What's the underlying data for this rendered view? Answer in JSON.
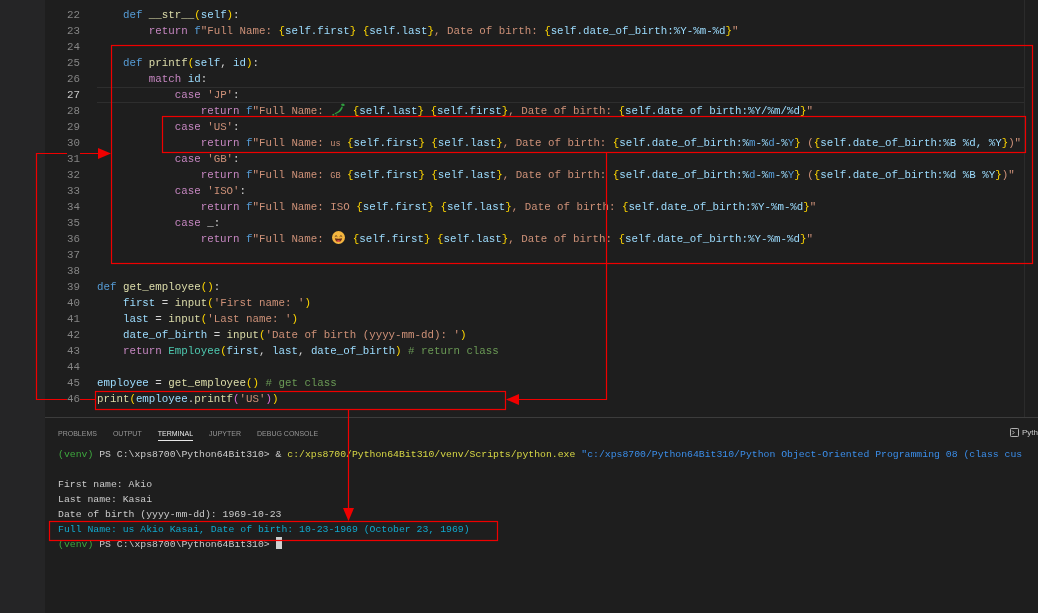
{
  "editor": {
    "lines": [
      {
        "number": "22",
        "current": false,
        "tokens": [
          {
            "kind": "keyword",
            "text": "    def "
          },
          {
            "kind": "function",
            "text": "__str__"
          },
          {
            "kind": "paren1",
            "text": "("
          },
          {
            "kind": "variable",
            "text": "self"
          },
          {
            "kind": "paren1",
            "text": ")"
          },
          {
            "kind": "plain",
            "text": ":"
          }
        ]
      },
      {
        "number": "23",
        "current": false,
        "tokens": [
          {
            "kind": "control",
            "text": "        return "
          },
          {
            "kind": "prefix",
            "text": "f"
          },
          {
            "kind": "string",
            "text": "\"Full Name: "
          },
          {
            "kind": "brace",
            "text": "{"
          },
          {
            "kind": "variable",
            "text": "self.first"
          },
          {
            "kind": "brace",
            "text": "} {"
          },
          {
            "kind": "variable",
            "text": "self.last"
          },
          {
            "kind": "brace",
            "text": "}"
          },
          {
            "kind": "string",
            "text": ", Date of birth: "
          },
          {
            "kind": "brace",
            "text": "{"
          },
          {
            "kind": "variable",
            "text": "self.date_of_birth:%Y-%m-%d"
          },
          {
            "kind": "brace",
            "text": "}"
          },
          {
            "kind": "string",
            "text": "\""
          }
        ]
      },
      {
        "number": "24",
        "current": false
      },
      {
        "number": "25",
        "current": false,
        "tokens": [
          {
            "kind": "keyword",
            "text": "    def "
          },
          {
            "kind": "function",
            "text": "printf"
          },
          {
            "kind": "paren1",
            "text": "("
          },
          {
            "kind": "variable",
            "text": "self"
          },
          {
            "kind": "plain",
            "text": ", "
          },
          {
            "kind": "variable",
            "text": "id"
          },
          {
            "kind": "paren1",
            "text": ")"
          },
          {
            "kind": "plain",
            "text": ":"
          }
        ]
      },
      {
        "number": "26",
        "current": false,
        "tokens": [
          {
            "kind": "control",
            "text": "        match "
          },
          {
            "kind": "variable",
            "text": "id"
          },
          {
            "kind": "plain",
            "text": ":"
          }
        ]
      },
      {
        "number": "27",
        "current": true,
        "tokens": [
          {
            "kind": "control",
            "text": "            case "
          },
          {
            "kind": "string",
            "text": "'JP'"
          },
          {
            "kind": "plain",
            "text": ":"
          }
        ]
      },
      {
        "number": "28",
        "current": false,
        "tokens": [
          {
            "kind": "control",
            "text": "                return "
          },
          {
            "kind": "prefix",
            "text": "f"
          },
          {
            "kind": "string",
            "text": "\"Full Name: "
          },
          {
            "kind": "map"
          },
          {
            "kind": "brace",
            "text": " {"
          },
          {
            "kind": "variable",
            "text": "self.last"
          },
          {
            "kind": "brace",
            "text": "} {"
          },
          {
            "kind": "variable",
            "text": "self.first"
          },
          {
            "kind": "brace",
            "text": "}"
          },
          {
            "kind": "string",
            "text": ", Date of birth: "
          },
          {
            "kind": "brace",
            "text": "{"
          },
          {
            "kind": "variable",
            "text": "self.date of birth:%Y/%m/%d"
          },
          {
            "kind": "brace",
            "text": "}"
          },
          {
            "kind": "string",
            "text": "\""
          }
        ]
      },
      {
        "number": "29",
        "current": false,
        "tokens": [
          {
            "kind": "control",
            "text": "            case "
          },
          {
            "kind": "string",
            "text": "'US'"
          },
          {
            "kind": "plain",
            "text": ":"
          }
        ]
      },
      {
        "number": "30",
        "current": false,
        "tokens": [
          {
            "kind": "control",
            "text": "                return "
          },
          {
            "kind": "prefix",
            "text": "f"
          },
          {
            "kind": "string",
            "text": "\"Full Name: "
          },
          {
            "kind": "flag",
            "text": "us"
          },
          {
            "kind": "brace",
            "text": " {"
          },
          {
            "kind": "variable",
            "text": "self.first"
          },
          {
            "kind": "brace",
            "text": "} {"
          },
          {
            "kind": "variable",
            "text": "self.last"
          },
          {
            "kind": "brace",
            "text": "}"
          },
          {
            "kind": "string",
            "text": ", Date of birth: "
          },
          {
            "kind": "brace",
            "text": "{"
          },
          {
            "kind": "variable",
            "text": "self.date_of_birth:%"
          },
          {
            "kind": "format",
            "text": "m"
          },
          {
            "kind": "variable",
            "text": "-%"
          },
          {
            "kind": "format",
            "text": "d"
          },
          {
            "kind": "variable",
            "text": "-%"
          },
          {
            "kind": "format",
            "text": "Y"
          },
          {
            "kind": "brace",
            "text": "}"
          },
          {
            "kind": "string",
            "text": " ("
          },
          {
            "kind": "brace",
            "text": "{"
          },
          {
            "kind": "variable",
            "text": "self.date_of_birth:%B %d, %Y"
          },
          {
            "kind": "brace",
            "text": "}"
          },
          {
            "kind": "string",
            "text": ")\""
          }
        ]
      },
      {
        "number": "31",
        "current": false,
        "tokens": [
          {
            "kind": "control",
            "text": "            case "
          },
          {
            "kind": "string",
            "text": "'GB'"
          },
          {
            "kind": "plain",
            "text": ":"
          }
        ]
      },
      {
        "number": "32",
        "current": false,
        "tokens": [
          {
            "kind": "control",
            "text": "                return "
          },
          {
            "kind": "prefix",
            "text": "f"
          },
          {
            "kind": "string",
            "text": "\"Full Name: "
          },
          {
            "kind": "flag",
            "text": "GB"
          },
          {
            "kind": "brace",
            "text": " {"
          },
          {
            "kind": "variable",
            "text": "self.first"
          },
          {
            "kind": "brace",
            "text": "} {"
          },
          {
            "kind": "variable",
            "text": "self.last"
          },
          {
            "kind": "brace",
            "text": "}"
          },
          {
            "kind": "string",
            "text": ", Date of birth: "
          },
          {
            "kind": "brace",
            "text": "{"
          },
          {
            "kind": "variable",
            "text": "self.date_of_birth:%"
          },
          {
            "kind": "format",
            "text": "d"
          },
          {
            "kind": "variable",
            "text": "-%"
          },
          {
            "kind": "format",
            "text": "m"
          },
          {
            "kind": "variable",
            "text": "-%"
          },
          {
            "kind": "format",
            "text": "Y"
          },
          {
            "kind": "brace",
            "text": "}"
          },
          {
            "kind": "string",
            "text": " ("
          },
          {
            "kind": "brace",
            "text": "{"
          },
          {
            "kind": "variable",
            "text": "self.date_of_birth:%d %B %Y"
          },
          {
            "kind": "brace",
            "text": "}"
          },
          {
            "kind": "string",
            "text": ")\""
          }
        ]
      },
      {
        "number": "33",
        "current": false,
        "tokens": [
          {
            "kind": "control",
            "text": "            case "
          },
          {
            "kind": "string",
            "text": "'ISO'"
          },
          {
            "kind": "plain",
            "text": ":"
          }
        ]
      },
      {
        "number": "34",
        "current": false,
        "tokens": [
          {
            "kind": "control",
            "text": "                return "
          },
          {
            "kind": "prefix",
            "text": "f"
          },
          {
            "kind": "string",
            "text": "\"Full Name: ISO "
          },
          {
            "kind": "brace",
            "text": "{"
          },
          {
            "kind": "variable",
            "text": "self.first"
          },
          {
            "kind": "brace",
            "text": "} {"
          },
          {
            "kind": "variable",
            "text": "self.last"
          },
          {
            "kind": "brace",
            "text": "}"
          },
          {
            "kind": "string",
            "text": ", Date of birth: "
          },
          {
            "kind": "brace",
            "text": "{"
          },
          {
            "kind": "variable",
            "text": "self.date_of_birth:%Y-%m-%d"
          },
          {
            "kind": "brace",
            "text": "}"
          },
          {
            "kind": "string",
            "text": "\""
          }
        ]
      },
      {
        "number": "35",
        "current": false,
        "tokens": [
          {
            "kind": "control",
            "text": "            case "
          },
          {
            "kind": "plain",
            "text": "_:"
          }
        ]
      },
      {
        "number": "36",
        "current": false,
        "tokens": [
          {
            "kind": "control",
            "text": "                return "
          },
          {
            "kind": "prefix",
            "text": "f"
          },
          {
            "kind": "string",
            "text": "\"Full Name: "
          },
          {
            "kind": "smiley"
          },
          {
            "kind": "brace",
            "text": " {"
          },
          {
            "kind": "variable",
            "text": "self.first"
          },
          {
            "kind": "brace",
            "text": "} {"
          },
          {
            "kind": "variable",
            "text": "self.last"
          },
          {
            "kind": "brace",
            "text": "}"
          },
          {
            "kind": "string",
            "text": ", Date of birth: "
          },
          {
            "kind": "brace",
            "text": "{"
          },
          {
            "kind": "variable",
            "text": "self.date_of_birth:%Y-%m-%d"
          },
          {
            "kind": "brace",
            "text": "}"
          },
          {
            "kind": "string",
            "text": "\""
          }
        ]
      },
      {
        "number": "37",
        "current": false
      },
      {
        "number": "38",
        "current": false
      },
      {
        "number": "39",
        "current": false,
        "tokens": [
          {
            "kind": "keyword",
            "text": "def "
          },
          {
            "kind": "function",
            "text": "get_employee"
          },
          {
            "kind": "paren1",
            "text": "()"
          },
          {
            "kind": "plain",
            "text": ":"
          }
        ]
      },
      {
        "number": "40",
        "current": false,
        "tokens": [
          {
            "kind": "variable",
            "text": "    first"
          },
          {
            "kind": "plain",
            "text": " = "
          },
          {
            "kind": "function",
            "text": "input"
          },
          {
            "kind": "paren1",
            "text": "("
          },
          {
            "kind": "string",
            "text": "'First name: '"
          },
          {
            "kind": "paren1",
            "text": ")"
          }
        ]
      },
      {
        "number": "41",
        "current": false,
        "tokens": [
          {
            "kind": "variable",
            "text": "    last"
          },
          {
            "kind": "plain",
            "text": " = "
          },
          {
            "kind": "function",
            "text": "input"
          },
          {
            "kind": "paren1",
            "text": "("
          },
          {
            "kind": "string",
            "text": "'Last name: '"
          },
          {
            "kind": "paren1",
            "text": ")"
          }
        ]
      },
      {
        "number": "42",
        "current": false,
        "tokens": [
          {
            "kind": "variable",
            "text": "    date_of_birth"
          },
          {
            "kind": "plain",
            "text": " = "
          },
          {
            "kind": "function",
            "text": "input"
          },
          {
            "kind": "paren1",
            "text": "("
          },
          {
            "kind": "string",
            "text": "'Date of birth (yyyy-mm-dd): '"
          },
          {
            "kind": "paren1",
            "text": ")"
          }
        ]
      },
      {
        "number": "43",
        "current": false,
        "tokens": [
          {
            "kind": "control",
            "text": "    return "
          },
          {
            "kind": "class",
            "text": "Employee"
          },
          {
            "kind": "paren1",
            "text": "("
          },
          {
            "kind": "variable",
            "text": "first"
          },
          {
            "kind": "plain",
            "text": ", "
          },
          {
            "kind": "variable",
            "text": "last"
          },
          {
            "kind": "plain",
            "text": ", "
          },
          {
            "kind": "variable",
            "text": "date_of_birth"
          },
          {
            "kind": "paren1",
            "text": ")"
          },
          {
            "kind": "comment",
            "text": " # return class"
          }
        ]
      },
      {
        "number": "44",
        "current": false
      },
      {
        "number": "45",
        "current": false,
        "tokens": [
          {
            "kind": "variable",
            "text": "employee"
          },
          {
            "kind": "plain",
            "text": " = "
          },
          {
            "kind": "function",
            "text": "get_employee"
          },
          {
            "kind": "paren1",
            "text": "()"
          },
          {
            "kind": "comment",
            "text": " # get class"
          }
        ]
      },
      {
        "number": "46",
        "current": false,
        "tokens": [
          {
            "kind": "function",
            "text": "print"
          },
          {
            "kind": "paren1",
            "text": "("
          },
          {
            "kind": "variable",
            "text": "employee"
          },
          {
            "kind": "plain",
            "text": "."
          },
          {
            "kind": "function",
            "text": "printf"
          },
          {
            "kind": "paren2",
            "text": "("
          },
          {
            "kind": "string",
            "text": "'US'"
          },
          {
            "kind": "paren2",
            "text": ")"
          },
          {
            "kind": "paren1",
            "text": ")"
          }
        ]
      }
    ]
  },
  "panel": {
    "tabs": [
      {
        "label": "PROBLEMS",
        "selected": false
      },
      {
        "label": "OUTPUT",
        "selected": false
      },
      {
        "label": "TERMINAL",
        "selected": true
      },
      {
        "label": "JUPYTER",
        "selected": false
      },
      {
        "label": "DEBUG CONSOLE",
        "selected": false
      }
    ],
    "terminal_label": "Pyth"
  },
  "terminal": {
    "cursor": true,
    "lines": [
      {
        "kind": "text",
        "segments": [
          {
            "kind": "env",
            "text": "(venv)"
          },
          {
            "kind": "text",
            "text": " PS C:\\xps8700\\Python64Bit310> & "
          },
          {
            "kind": "path",
            "text": "c:/xps8700/Python64Bit310/venv/Scripts/python.exe "
          },
          {
            "kind": "arg",
            "text": "\"c:/xps8700/Python64Bit310/Python Object-Oriented Programming 08 (class cus"
          }
        ]
      },
      {
        "kind": "blank"
      },
      {
        "kind": "text",
        "segments": [
          {
            "kind": "text",
            "text": "First name: Akio"
          }
        ]
      },
      {
        "kind": "text",
        "segments": [
          {
            "kind": "text",
            "text": "Last name: Kasai"
          }
        ]
      },
      {
        "kind": "text",
        "segments": [
          {
            "kind": "text",
            "text": "Date of birth (yyyy-mm-dd): 1969-10-23"
          }
        ]
      },
      {
        "kind": "text",
        "segments": [
          {
            "kind": "output",
            "text": "Full Name: us Akio Kasai, Date of birth: 10-23-1969 (October 23, 1969)"
          }
        ]
      },
      {
        "kind": "text",
        "segments": [
          {
            "kind": "env",
            "text": "(venv)"
          },
          {
            "kind": "text",
            "text": " PS C:\\xps8700\\Python64Bit310>"
          }
        ]
      }
    ]
  }
}
